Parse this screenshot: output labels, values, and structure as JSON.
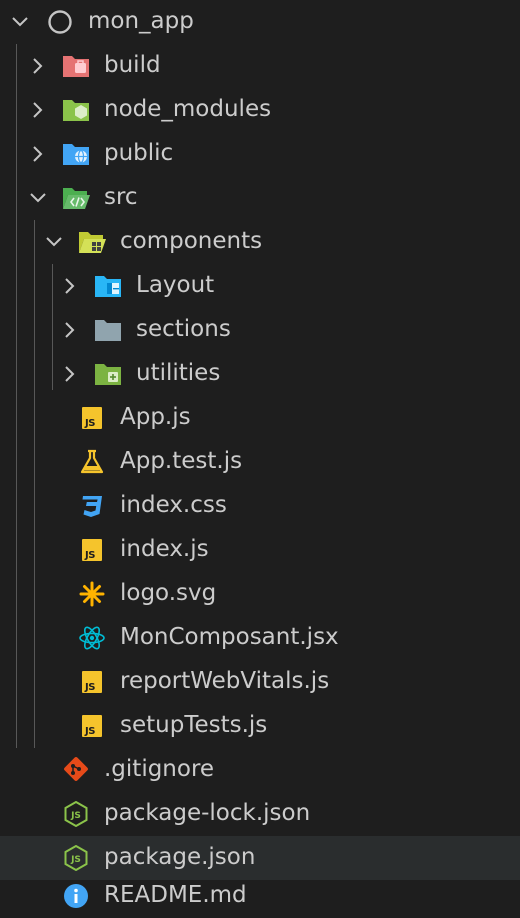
{
  "root": {
    "label": "mon_app",
    "icon": "circle-icon"
  },
  "items": [
    {
      "label": "build",
      "icon": "folder-build-icon"
    },
    {
      "label": "node_modules",
      "icon": "folder-node-icon"
    },
    {
      "label": "public",
      "icon": "folder-public-icon"
    },
    {
      "label": "src",
      "icon": "folder-src-open-icon"
    },
    {
      "label": "components",
      "icon": "folder-components-open-icon"
    },
    {
      "label": "Layout",
      "icon": "folder-layout-icon"
    },
    {
      "label": "sections",
      "icon": "folder-icon"
    },
    {
      "label": "utilities",
      "icon": "folder-utilities-icon"
    },
    {
      "label": "App.js",
      "icon": "javascript-icon"
    },
    {
      "label": "App.test.js",
      "icon": "test-flask-icon"
    },
    {
      "label": "index.css",
      "icon": "css-icon"
    },
    {
      "label": "index.js",
      "icon": "javascript-icon"
    },
    {
      "label": "logo.svg",
      "icon": "svg-asterisk-icon"
    },
    {
      "label": "MonComposant.jsx",
      "icon": "react-icon"
    },
    {
      "label": "reportWebVitals.js",
      "icon": "javascript-icon"
    },
    {
      "label": "setupTests.js",
      "icon": "javascript-icon"
    },
    {
      "label": ".gitignore",
      "icon": "git-icon"
    },
    {
      "label": "package-lock.json",
      "icon": "nodejs-icon"
    },
    {
      "label": "package.json",
      "icon": "nodejs-icon"
    },
    {
      "label": "README.md",
      "icon": "info-icon"
    }
  ],
  "js_badge": "JS",
  "colors": {
    "background": "#1e1e1e",
    "hover_row": "#2a2d2e",
    "text": "#cccccc",
    "javascript": "#f5c42c",
    "css": "#42a5f5",
    "react": "#00bcd4",
    "git": "#e64a19",
    "nodejs": "#8bc34a",
    "info": "#42a5f5"
  }
}
